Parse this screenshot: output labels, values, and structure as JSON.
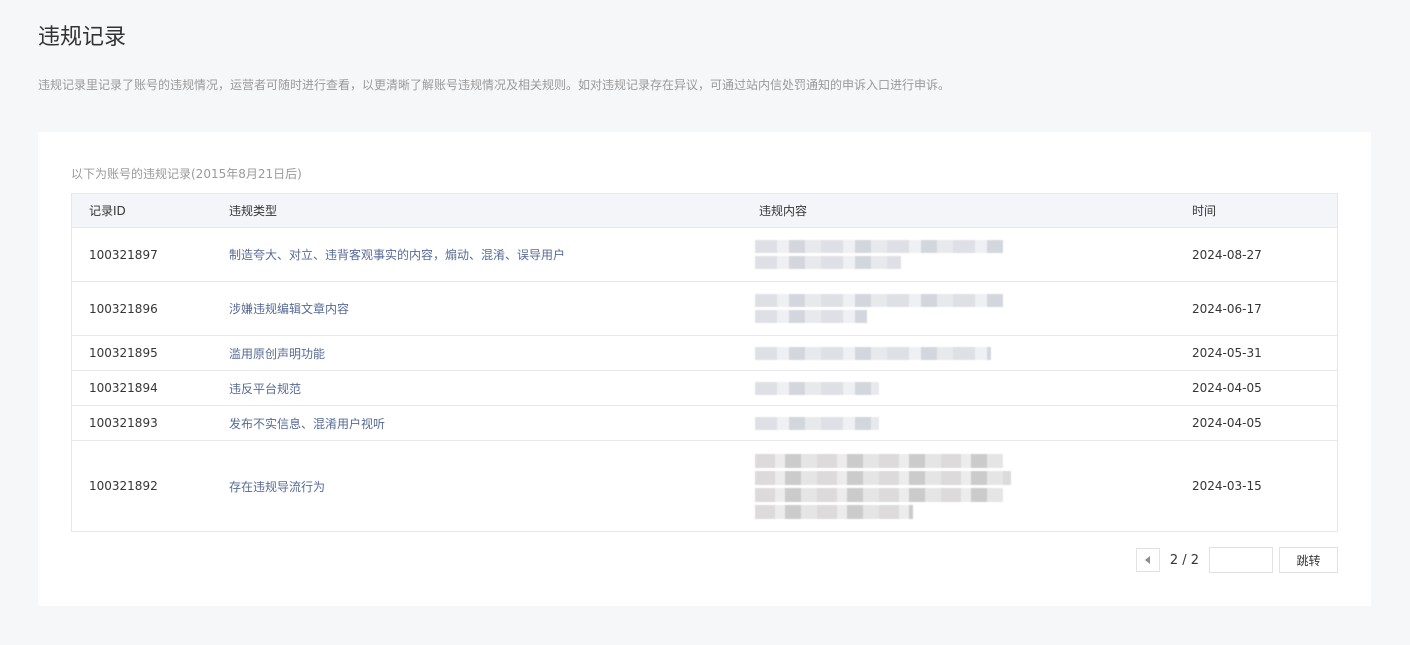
{
  "header": {
    "title": "违规记录",
    "description": "违规记录里记录了账号的违规情况，运营者可随时进行查看，以更清晰了解账号违规情况及相关规则。如对违规记录存在异议，可通过站内信处罚通知的申诉入口进行申诉。"
  },
  "card": {
    "caption": "以下为账号的违规记录(2015年8月21日后)"
  },
  "table": {
    "columns": [
      "记录ID",
      "违规类型",
      "违规内容",
      "时间"
    ],
    "rows": [
      {
        "id": "100321897",
        "type": "制造夸大、对立、违背客观事实的内容，煽动、混淆、误导用户",
        "time": "2024-08-27"
      },
      {
        "id": "100321896",
        "type": "涉嫌违规编辑文章内容",
        "time": "2024-06-17"
      },
      {
        "id": "100321895",
        "type": "滥用原创声明功能",
        "time": "2024-05-31"
      },
      {
        "id": "100321894",
        "type": "违反平台规范",
        "time": "2024-04-05"
      },
      {
        "id": "100321893",
        "type": "发布不实信息、混淆用户视听",
        "time": "2024-04-05"
      },
      {
        "id": "100321892",
        "type": "存在违规导流行为",
        "time": "2024-03-15"
      }
    ]
  },
  "pager": {
    "count": "2 / 2",
    "jump_label": "跳转",
    "input_value": ""
  },
  "icons": {
    "prev": "chevron-left-icon"
  },
  "colors": {
    "link": "#576b95",
    "background": "#f6f7f9"
  }
}
